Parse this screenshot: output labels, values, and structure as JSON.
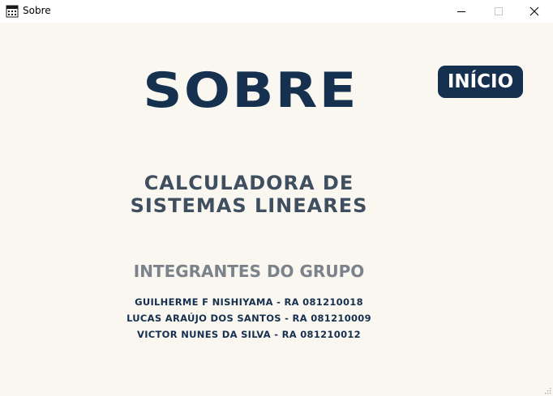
{
  "window": {
    "title": "Sobre",
    "icon": "calculator-icon"
  },
  "header": {
    "title": "SOBRE",
    "home_button_label": "INÍCIO"
  },
  "main": {
    "subtitle_line1": "CALCULADORA DE",
    "subtitle_line2": "SISTEMAS LINEARES",
    "group_heading": "INTEGRANTES DO GRUPO",
    "members": [
      "GUILHERME F NISHIYAMA - RA 081210018",
      "LUCAS ARAÚJO DOS SANTOS - RA 081210009",
      "VICTOR NUNES DA SILVA - RA 081210012"
    ]
  },
  "colors": {
    "background": "#faf7f1",
    "primary": "#16304f",
    "subtitle": "#3f4f5f",
    "muted": "#7b828a"
  }
}
